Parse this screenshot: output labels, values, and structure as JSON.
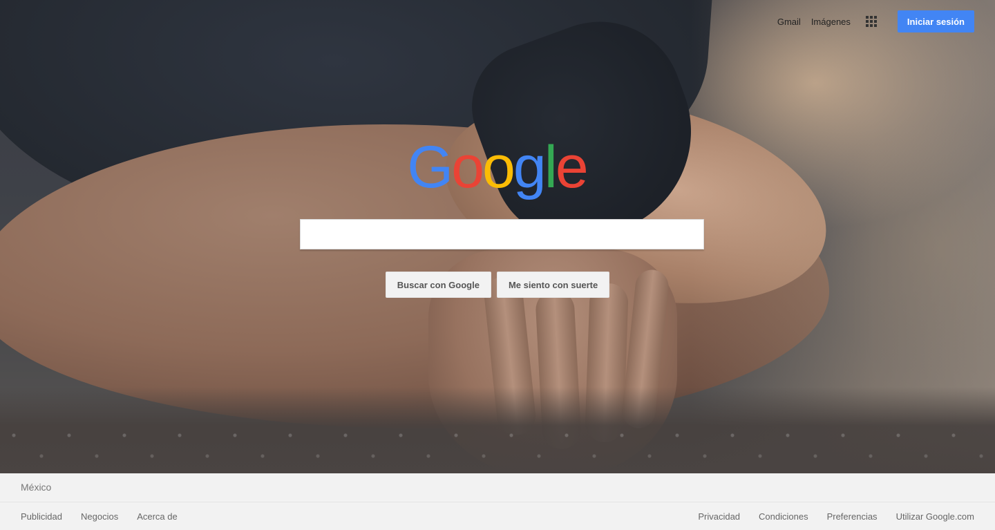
{
  "header": {
    "gmail_label": "Gmail",
    "images_label": "Imágenes",
    "apps_icon": "apps-grid-icon",
    "signin_label": "Iniciar sesión",
    "signin_color": "#4285f4"
  },
  "logo": {
    "letters": [
      "G",
      "o",
      "o",
      "g",
      "l",
      "e"
    ],
    "colors": [
      "#4285f4",
      "#ea4335",
      "#fbbc05",
      "#4285f4",
      "#34a853",
      "#ea4335"
    ]
  },
  "search": {
    "value": "",
    "placeholder": ""
  },
  "buttons": {
    "search_label": "Buscar con Google",
    "lucky_label": "Me siento con suerte"
  },
  "footer": {
    "country": "México",
    "left_links": [
      "Publicidad",
      "Negocios",
      "Acerca de"
    ],
    "right_links": [
      "Privacidad",
      "Condiciones",
      "Preferencias",
      "Utilizar Google.com"
    ]
  }
}
